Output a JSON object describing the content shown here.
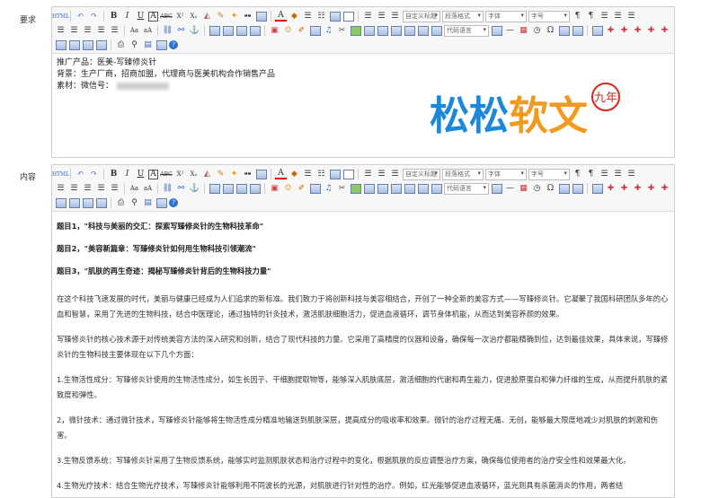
{
  "fields": {
    "requirements_label": "要求",
    "content_label": "内容"
  },
  "toolbar": {
    "custom_heading": "自定义标题",
    "paragraph_format": "段落格式",
    "font_family": "字体",
    "font_size": "字号",
    "code_language": "代码语言",
    "bold": "B",
    "italic": "I",
    "underline": "U",
    "font_border": "A",
    "strikethrough": "ABC",
    "superscript": "X²",
    "subscript": "X₂",
    "quote": "❝❝",
    "font_color": "A"
  },
  "requirements": {
    "line1": "推广产品：医美-写臻修炎针",
    "line2": "背景：生产厂商，招商加盟，代理商与医美机构合作销售产品",
    "line3": "素材：微信号：",
    "logo": {
      "text": "松松软文",
      "stamp": "九年"
    }
  },
  "content": {
    "titles": [
      "题目1，\"科技与美丽的交汇：探索写臻修炎针的生物科技革命\"",
      "题目2，\"美容新篇章：写臻修炎针如何用生物科技引领潮流\"",
      "题目3，\"肌肤的再生奇迹：揭秘写臻修炎针背后的生物科技力量\""
    ],
    "paragraphs": [
      "在这个科技飞速发展的时代，美丽与健康已经成为人们追求的新标准。我们致力于将创新科技与美容相结合，开创了一种全新的美容方式——写臻修炎针。它凝聚了我国科研团队多年的心血和智慧，采用了先进的生物科技，结合中医理论，通过独特的针灸技术，激活肌肤细胞活力，促进血液循环，调节身体机能，从而达到美容养颜的效果。",
      "写臻修炎针的核心技术源于对传统美容方法的深入研究和创新，结合了现代科技的力量。它采用了高精度的仪器和设备，确保每一次治疗都能精确到位，达到最佳效果，具体来说，写臻修炎针的生物科技主要体现在以下几个方面：",
      "1.生物活性成分：写臻修炎针使用的生物活性成分，如生长因子、干细胞提取物等，能够深入肌肤底层，激活细胞的代谢和再生能力，促进胶原蛋白和弹力纤维的生成，从而提升肌肤的紧致度和弹性。",
      "2，微针技术：通过微针技术，写臻修炎针能够将生物活性成分精准地输送到肌肤深层，提高成分的吸收率和效果。微针的治疗过程无痛、无创，能够最大限度地减少对肌肤的刺激和伤害。",
      "3.生物反馈系统：写臻修炎针采用了生物反馈系统，能够实时监测肌肤状态和治疗过程中的变化，根据肌肤的反应调整治疗方案，确保每位使用者的治疗安全性和效果最大化。",
      "4.生物光疗技术：结合生物光疗技术，写臻修炎针能够利用不同波长的光源，对肌肤进行针对性的治疗。例如，红光能够促进血液循环，蓝光则具有杀菌消炎的作用，两者结"
    ]
  },
  "colors": {
    "logo_blue": "#1e88d8",
    "logo_orange": "#f29a1f",
    "stamp_red": "#d9261c"
  }
}
